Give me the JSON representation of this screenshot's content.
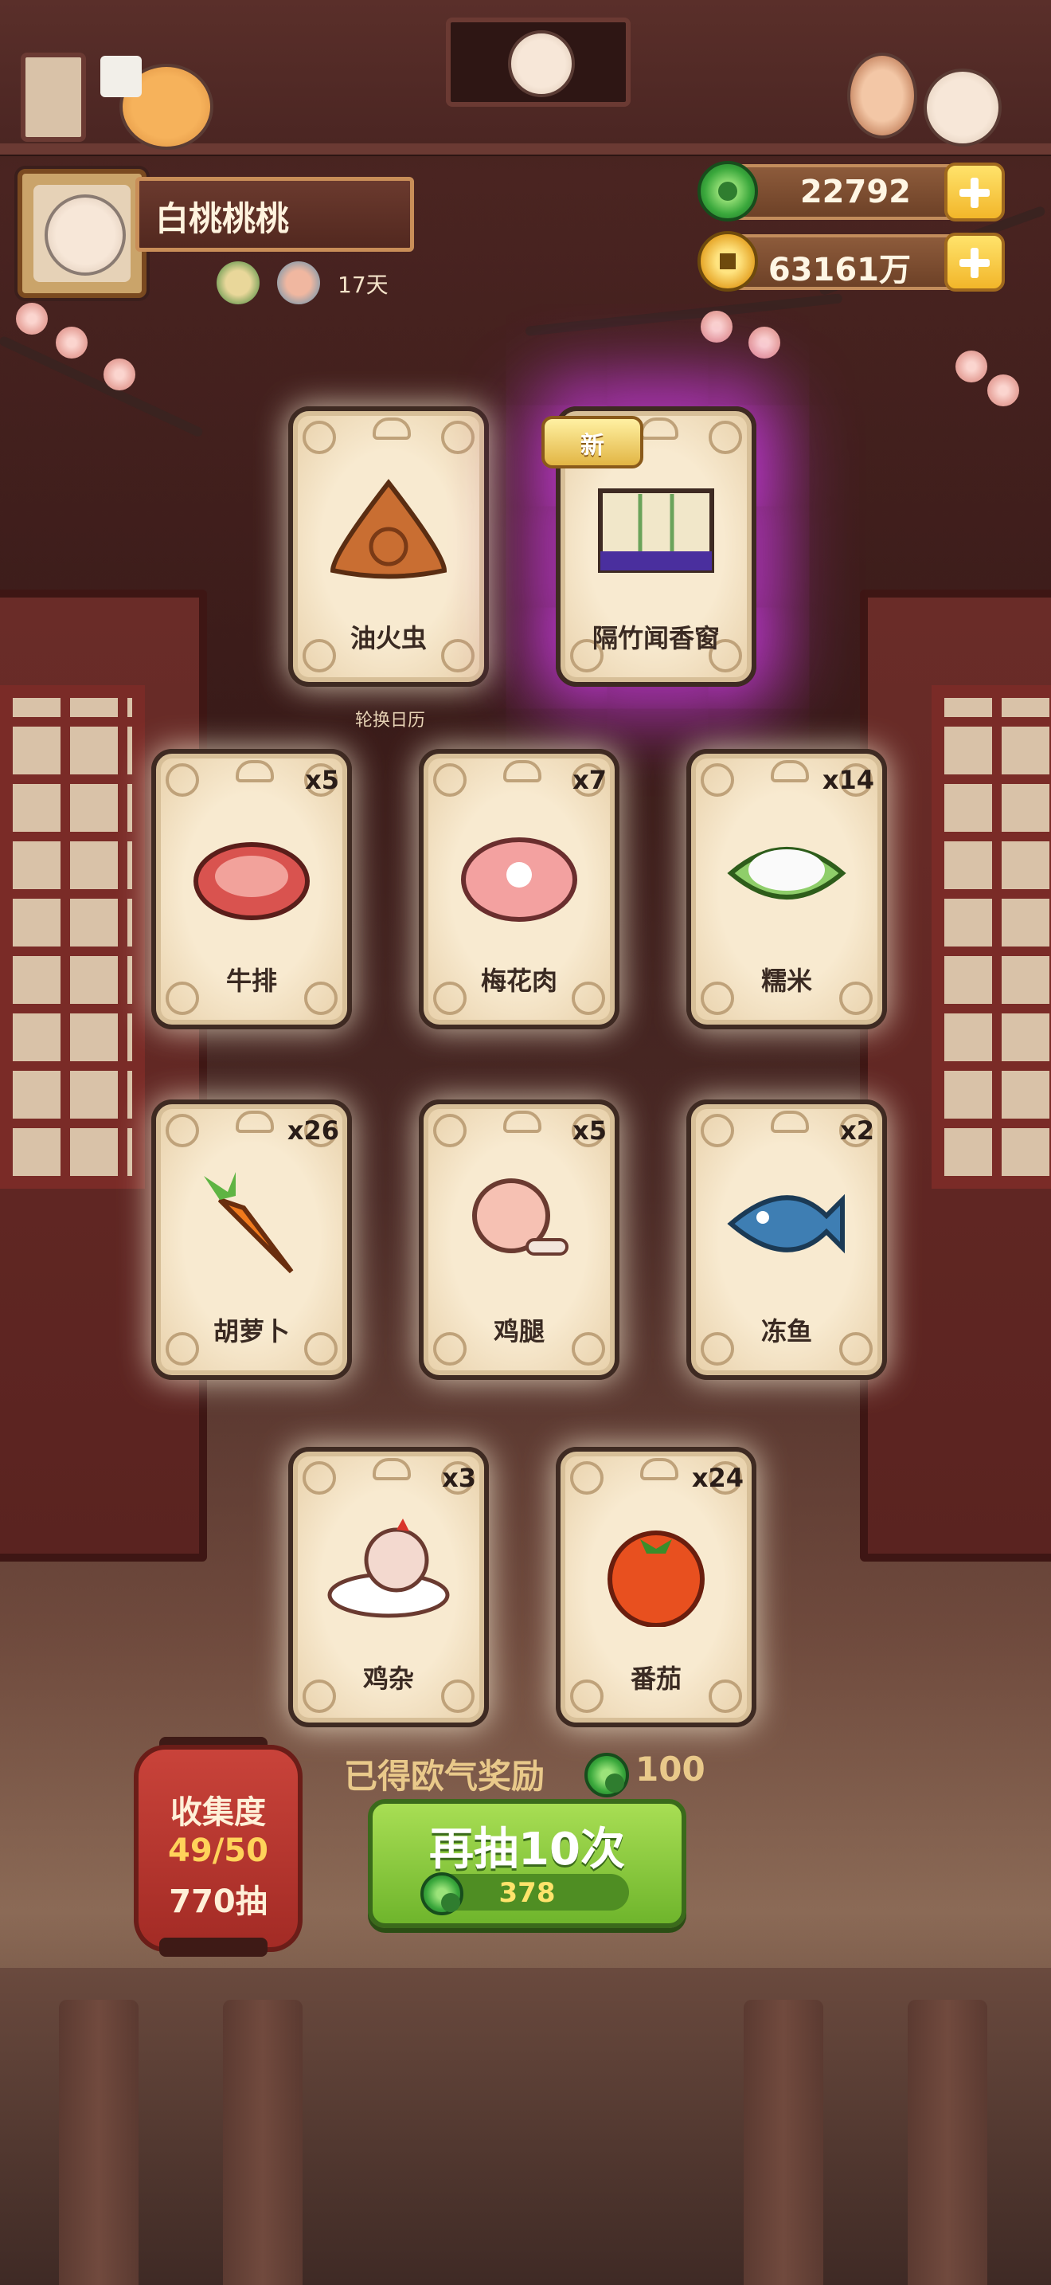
{
  "profile": {
    "name": "白桃桃桃",
    "days": "17天"
  },
  "currency": {
    "jade": "22792",
    "gold": "63161万"
  },
  "featured": [
    {
      "label": "油火虫",
      "count": "",
      "icon": "dumpling-icon"
    },
    {
      "label": "隔竹闻香窗",
      "count": "",
      "icon": "bamboo-window-icon",
      "new": "新"
    }
  ],
  "featured_caption": "轮换日历",
  "cards": [
    {
      "label": "牛排",
      "count": "x5",
      "icon": "steak-icon"
    },
    {
      "label": "梅花肉",
      "count": "x7",
      "icon": "pork-icon"
    },
    {
      "label": "糯米",
      "count": "x14",
      "icon": "rice-icon"
    },
    {
      "label": "胡萝卜",
      "count": "x26",
      "icon": "carrot-icon"
    },
    {
      "label": "鸡腿",
      "count": "x5",
      "icon": "drumstick-icon"
    },
    {
      "label": "冻鱼",
      "count": "x2",
      "icon": "fish-icon"
    },
    {
      "label": "鸡杂",
      "count": "x3",
      "icon": "chicken-icon"
    },
    {
      "label": "番茄",
      "count": "x24",
      "icon": "tomato-icon"
    }
  ],
  "collection": {
    "title": "收集度",
    "progress": "49/50",
    "draws": "770抽"
  },
  "reward": {
    "text": "已得欧气奖励",
    "value": "100"
  },
  "draw_button": {
    "label": "再抽10次",
    "cost": "378"
  },
  "colors": {
    "accent_green": "#6fb52c",
    "gold": "#e9c98a",
    "purple_glow": "#d23cf0"
  }
}
